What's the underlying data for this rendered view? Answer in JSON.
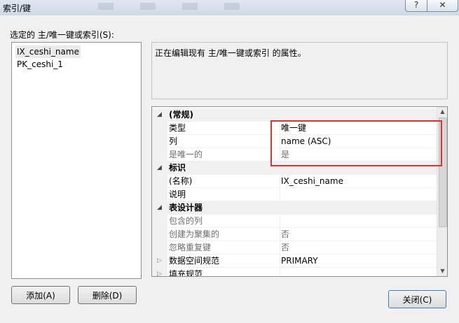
{
  "window": {
    "title": "索引/键",
    "help_label": "?",
    "close_label": "✕"
  },
  "list": {
    "label": "选定的 主/唯一键或索引(S):",
    "items": [
      "IX_ceshi_name",
      "PK_ceshi_1"
    ],
    "selected_index": 0
  },
  "description": "正在编辑现有 主/唯一键或索引 的属性。",
  "properties": {
    "categories": {
      "general": "(常规)",
      "identity": "标识",
      "table_designer": "表设计器"
    },
    "rows": [
      {
        "name": "类型",
        "value": "唯一键"
      },
      {
        "name": "列",
        "value": "name (ASC)"
      },
      {
        "name": "是唯一的",
        "value": "是"
      },
      {
        "name": "(名称)",
        "value": "IX_ceshi_name"
      },
      {
        "name": "说明",
        "value": ""
      },
      {
        "name": "包含的列",
        "value": ""
      },
      {
        "name": "创建为聚集的",
        "value": "否"
      },
      {
        "name": "忽略重复键",
        "value": "否"
      },
      {
        "name": "数据空间规范",
        "value": "PRIMARY"
      },
      {
        "name": "填充规范",
        "value": ""
      }
    ]
  },
  "buttons": {
    "add": "添加(A)",
    "delete": "删除(D)",
    "close": "关闭(C)"
  },
  "colors": {
    "highlight": "#e03030",
    "window_bg": "#f0f0f0",
    "category_bg": "#f0f0f0"
  }
}
